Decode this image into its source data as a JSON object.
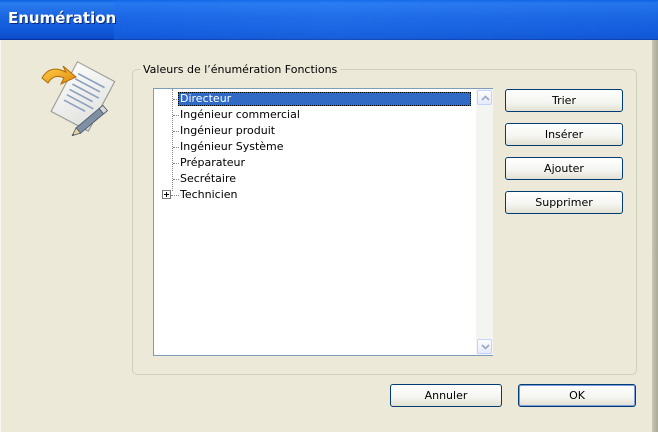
{
  "window": {
    "title": "Enumération"
  },
  "group": {
    "label": "Valeurs de l’énumération Fonctions"
  },
  "list": {
    "items": [
      {
        "label": "Directeur",
        "selected": true,
        "expandable": false
      },
      {
        "label": "Ingénieur commercial",
        "selected": false,
        "expandable": false
      },
      {
        "label": "Ingénieur produit",
        "selected": false,
        "expandable": false
      },
      {
        "label": "Ingénieur Système",
        "selected": false,
        "expandable": false
      },
      {
        "label": "Préparateur",
        "selected": false,
        "expandable": false
      },
      {
        "label": "Secrétaire",
        "selected": false,
        "expandable": false
      },
      {
        "label": "Technicien",
        "selected": false,
        "expandable": true
      }
    ]
  },
  "actions": {
    "sort_label": "Trier",
    "insert_label": "Insérer",
    "add_label": "Ajouter",
    "delete_label": "Supprimer"
  },
  "footer": {
    "cancel_label": "Annuler",
    "ok_label": "OK"
  },
  "icons": {
    "dialog_icon": "document-edit-icon",
    "scroll_up": "chevron-up-icon",
    "scroll_down": "chevron-down-icon",
    "expander": "plus-box-icon"
  },
  "colors": {
    "titlebar": "#1a64e0",
    "selection": "#316ac5",
    "dialog_bg": "#ece9d8",
    "button_border": "#003c74"
  }
}
